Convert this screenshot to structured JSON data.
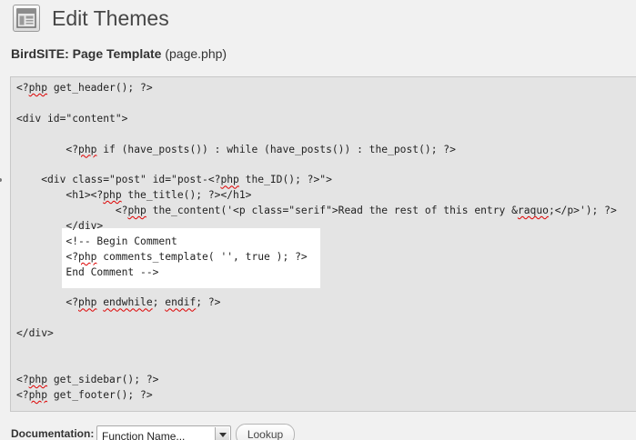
{
  "header": {
    "title": "Edit Themes",
    "icon": "appearance-icon"
  },
  "subtitle": {
    "theme_name": "BirdSITE: Page Template",
    "file_name": "(page.php)"
  },
  "editor": {
    "lines": [
      "<?php get_header(); ?>",
      "",
      "<div id=\"content\">",
      "",
      "        <?php if (have_posts()) : while (have_posts()) : the_post(); ?>",
      "",
      "    <div class=\"post\" id=\"post-<?php the_ID(); ?>\">",
      "        <h1><?php the_title(); ?></h1>",
      "                <?php the_content('<p class=\"serif\">Read the rest of this entry &raquo;</p>'); ?>",
      "        </div>",
      "        <!-- Begin Comment",
      "        <?php comments_template( '', true ); ?>",
      "        End Comment -->",
      "",
      "        <?php endwhile; endif; ?>",
      "",
      "</div>",
      "",
      "",
      "<?php get_sidebar(); ?>",
      "<?php get_footer(); ?>"
    ]
  },
  "documentation": {
    "label": "Documentation:",
    "select_value": "Function Name...",
    "lookup_label": "Lookup"
  }
}
